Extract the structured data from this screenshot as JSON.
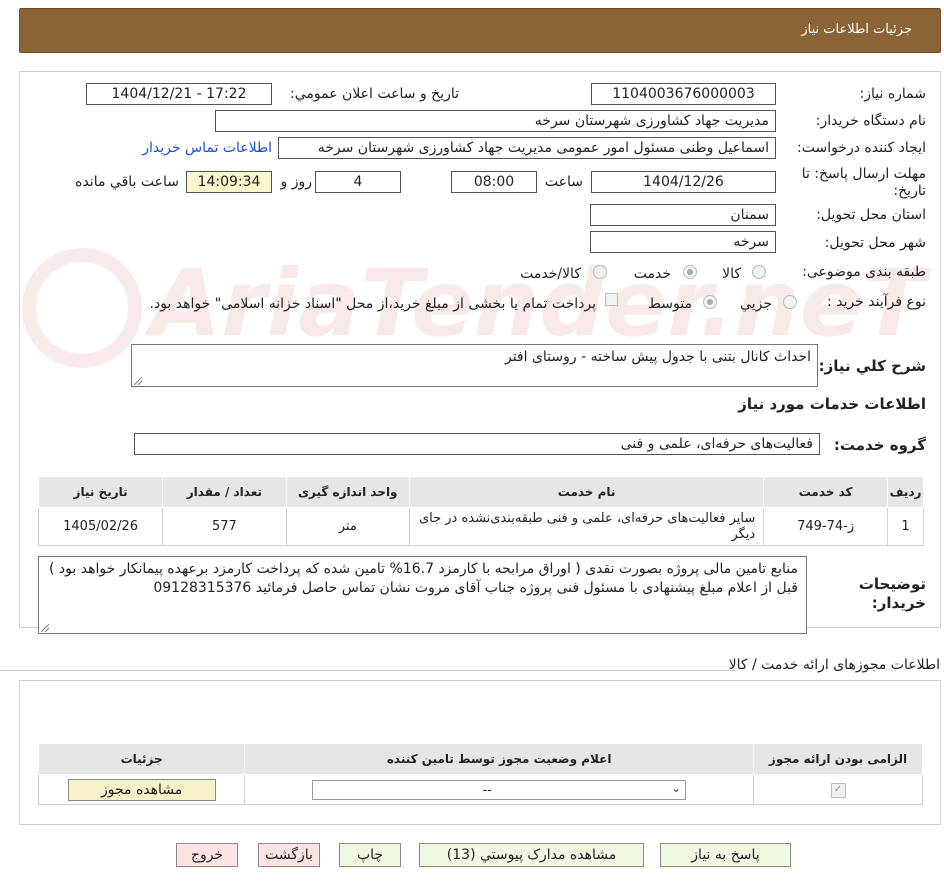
{
  "header": {
    "title": "جزئیات اطلاعات نیاز"
  },
  "watermark": "AriaTender.neT",
  "fields": {
    "need_number_label": "شماره نیاز:",
    "need_number": "1104003676000003",
    "announce_label": "تاریخ و ساعت اعلان عمومي:",
    "announce_value": "1404/12/21 - 17:22",
    "buyer_org_label": "نام دستگاه خریدار:",
    "buyer_org": "مدیریت جهاد کشاورزی شهرستان سرخه",
    "requester_label": "ایجاد کننده درخواست:",
    "requester": "اسماعیل وطنی مسئول امور عمومی مدیریت جهاد کشاورزی شهرستان سرخه",
    "contact_link": "اطلاعات تماس خریدار",
    "deadline_label": "مهلت ارسال پاسخ: تا تاریخ:",
    "deadline_date": "1404/12/26",
    "time_label": "ساعت",
    "deadline_time": "08:00",
    "days_value": "4",
    "days_label": "روز و",
    "remaining_time": "14:09:34",
    "remaining_label": "ساعت باقي مانده",
    "province_label": "استان محل تحویل:",
    "province": "سمنان",
    "city_label": "شهر محل تحویل:",
    "city": "سرخه",
    "category_label": "طبقه بندی موضوعی:",
    "category_options": [
      "کالا",
      "خدمت",
      "کالا/خدمت"
    ],
    "purchase_type_label": "نوع فرآیند خرید :",
    "purchase_options": [
      "جزيي",
      "متوسط"
    ],
    "payment_note": "پرداخت تمام یا بخشی از مبلغ خرید،از محل \"اسناد خزانه اسلامی\" خواهد بود."
  },
  "description": {
    "label": "شرح کلي نیاز:",
    "value": "احداث کانال بتنی با جدول پیش ساخته - روستای افتر"
  },
  "services_title": "اطلاعات خدمات مورد نیاز",
  "service_group": {
    "label": "گروه خدمت:",
    "value": "فعالیت‌های حرفه‌ای، علمی و فنی"
  },
  "services_table": {
    "headers": [
      "ردیف",
      "کد خدمت",
      "نام خدمت",
      "واحد اندازه گیری",
      "تعداد / مقدار",
      "تاریخ نیاز"
    ],
    "rows": [
      {
        "row": "1",
        "code": "ز-74-749",
        "name": "سایر فعالیت‌های حرفه‌ای، علمی و فنی طبقه‌بندی‌نشده در جای دیگر",
        "unit": "متر",
        "qty": "577",
        "date": "1405/02/26"
      }
    ]
  },
  "buyer_notes": {
    "label": "توضیحات خریدار:",
    "line1": "منابع تامین مالی پروژه بصورت نقدی ( اوراق مرابحه با کارمزد 16.7% تامین شده که پرداخت کارمزد برعهده پیمانکار خواهد بود )",
    "line2": "قبل از اعلام مبلغ پیشنهادی با مسئول فنی پروژه جناب آقای مروت نشان تماس حاصل فرمائید 09128315376"
  },
  "permits": {
    "title": "اطلاعات مجوزهای ارائه خدمت / کالا",
    "headers": [
      "الزامی بودن ارائه مجوز",
      "اعلام وضعیت مجوز توسط تامین کننده",
      "جزئیات"
    ],
    "select_value": "--",
    "view_button": "مشاهده مجوز"
  },
  "buttons": {
    "reply": "پاسخ به نیاز",
    "attachments": "مشاهده مدارک پیوستي (13)",
    "print": "چاپ",
    "back": "بازگشت",
    "exit": "خروج"
  }
}
